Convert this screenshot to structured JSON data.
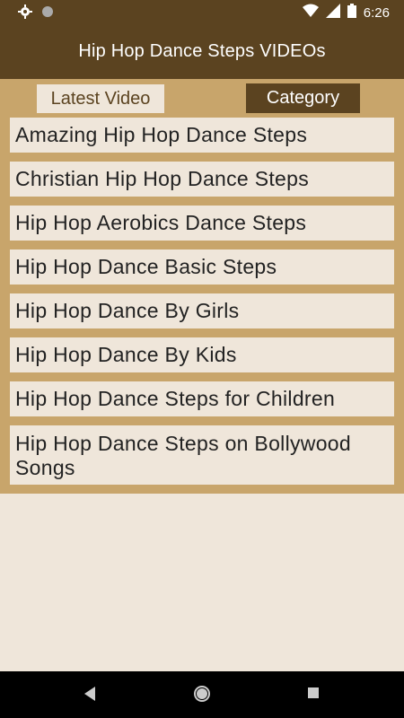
{
  "status": {
    "time": "6:26"
  },
  "app": {
    "title": "Hip Hop Dance Steps VIDEOs"
  },
  "tabs": [
    {
      "label": "Latest Video"
    },
    {
      "label": "Category"
    }
  ],
  "categories": [
    "Amazing Hip Hop Dance Steps",
    "Christian Hip Hop Dance Steps",
    "Hip Hop Aerobics Dance Steps",
    "Hip Hop Dance Basic Steps",
    "Hip Hop Dance By Girls",
    "Hip Hop Dance By Kids",
    "Hip Hop Dance Steps for Children",
    "Hip Hop Dance Steps on Bollywood Songs"
  ],
  "colors": {
    "accent": "#5b4320",
    "panel": "#c8a56b",
    "surface": "#efe6da"
  },
  "icons": [
    "settings-icon",
    "record-icon",
    "wifi-icon",
    "signal-icon",
    "battery-icon",
    "back-icon",
    "home-icon",
    "recents-icon"
  ]
}
